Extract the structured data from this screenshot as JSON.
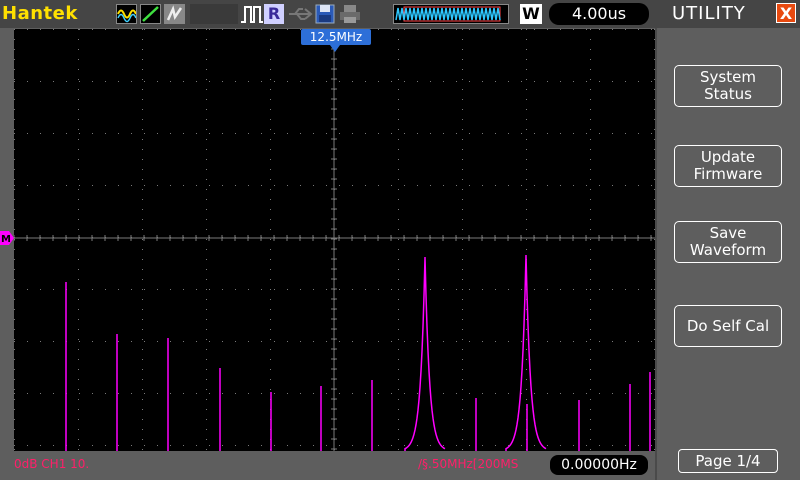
{
  "brand": "Hantek",
  "toolbar": {
    "mode_icons": [
      "wave-icon",
      "ramp-icon",
      "persist-icon"
    ],
    "trigger_icon": "pulse-trigger-icon",
    "run_state": "R",
    "usb_icon": "usb-icon",
    "save_icon": "floppy-icon",
    "print_icon": "printer-icon",
    "memory_icon": "waveform-memory-icon",
    "window_label": "W",
    "timebase": "4.00us"
  },
  "scope": {
    "center_freq_marker": "12.5MHz",
    "channel_marker": "M",
    "trace_color": "#ff00ff",
    "grid_color": "#7a7a7a"
  },
  "status": {
    "channel_info": "0dB  CH1 10.",
    "fft_info": "/§.50MHz[200MS",
    "freq_readout": "0.00000Hz"
  },
  "menu": {
    "title": "UTILITY",
    "close_label": "X",
    "buttons": [
      {
        "label": "System\nStatus"
      },
      {
        "label": "Update\nFirmware"
      },
      {
        "label": "Save\nWaveform"
      },
      {
        "label": "Do Self Cal"
      }
    ],
    "page": "Page 1/4"
  },
  "colors": {
    "brand": "#ffe000",
    "accent_marker": "#2d6fd8",
    "status_text": "#ff1f6a",
    "close": "#e84a10"
  }
}
